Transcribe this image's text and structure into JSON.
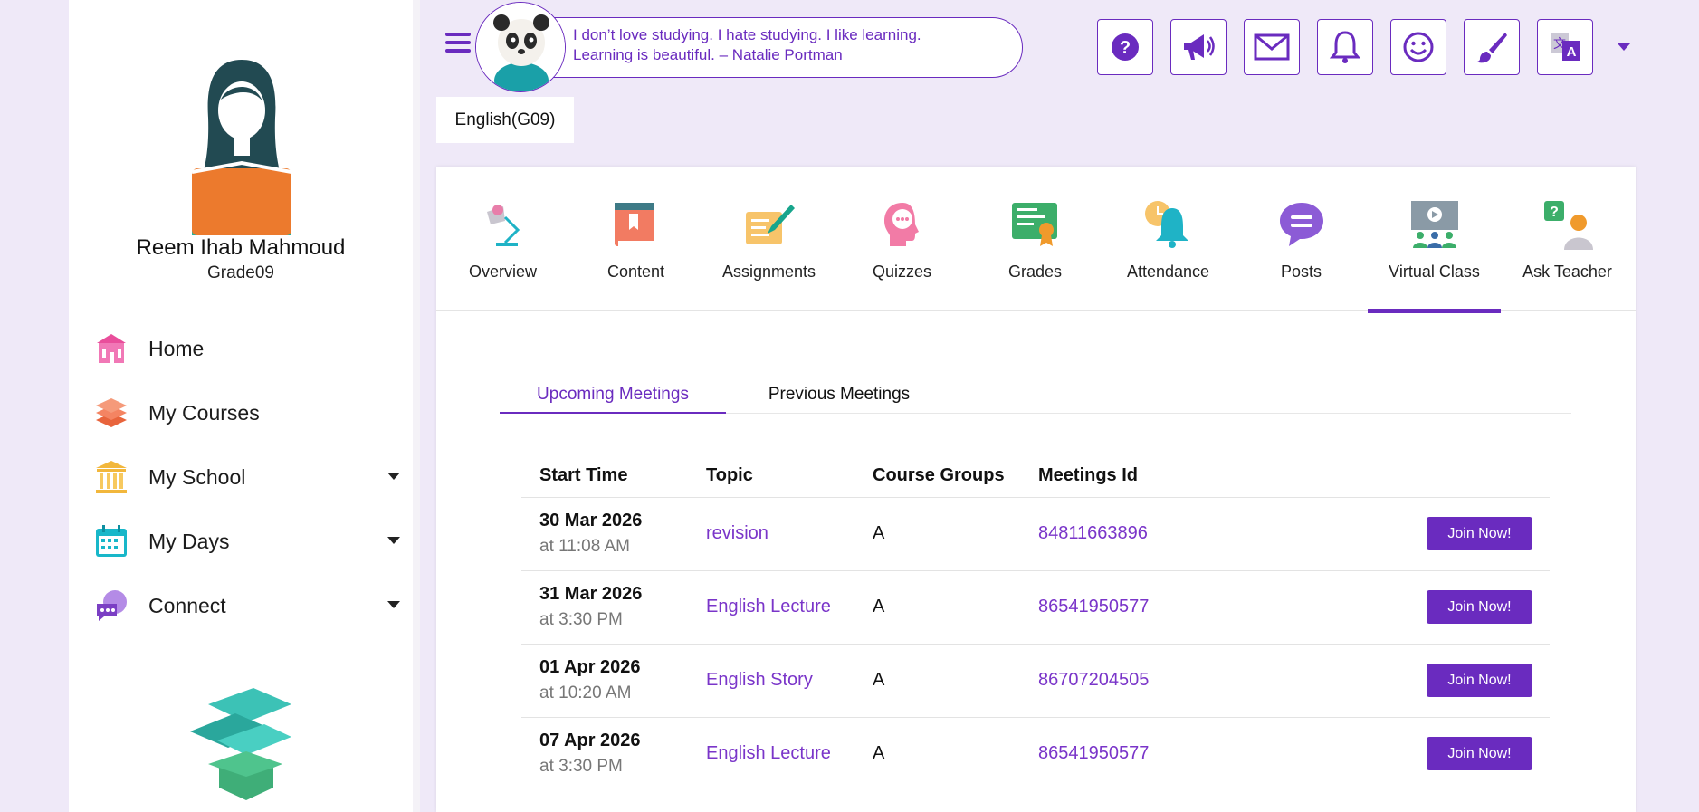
{
  "sidebar": {
    "student_name": "Reem Ihab Mahmoud",
    "grade": "Grade09",
    "nav": [
      {
        "label": "Home",
        "icon": "school-building-icon",
        "has_caret": false
      },
      {
        "label": "My Courses",
        "icon": "books-stack-icon",
        "has_caret": false
      },
      {
        "label": "My School",
        "icon": "institution-columns-icon",
        "has_caret": true
      },
      {
        "label": "My Days",
        "icon": "calendar-icon",
        "has_caret": true
      },
      {
        "label": "Connect",
        "icon": "chat-bubbles-icon",
        "has_caret": true
      }
    ]
  },
  "header": {
    "quote": "I don’t love studying. I hate studying. I like learning. Learning is beautiful. – Natalie Portman",
    "buttons": [
      "help-icon",
      "megaphone-icon",
      "mail-icon",
      "bell-icon",
      "smiley-icon",
      "brush-icon",
      "translate-icon"
    ]
  },
  "course": {
    "name": "English(G09)"
  },
  "course_tabs": [
    {
      "label": "Overview",
      "icon": "desk-lamp-icon",
      "active": false
    },
    {
      "label": "Content",
      "icon": "book-icon",
      "active": false
    },
    {
      "label": "Assignments",
      "icon": "pen-paper-icon",
      "active": false
    },
    {
      "label": "Quizzes",
      "icon": "head-thought-icon",
      "active": false
    },
    {
      "label": "Grades",
      "icon": "certificate-icon",
      "active": false
    },
    {
      "label": "Attendance",
      "icon": "bell-clock-icon",
      "active": false
    },
    {
      "label": "Posts",
      "icon": "speech-bubble-icon",
      "active": false
    },
    {
      "label": "Virtual Class",
      "icon": "presentation-icon",
      "active": true
    },
    {
      "label": "Ask Teacher",
      "icon": "question-person-icon",
      "active": false
    }
  ],
  "meetings": {
    "tabs": {
      "upcoming": "Upcoming Meetings",
      "previous": "Previous Meetings"
    },
    "columns": {
      "start_time": "Start Time",
      "topic": "Topic",
      "groups": "Course Groups",
      "id": "Meetings Id"
    },
    "join_label": "Join Now!",
    "rows": [
      {
        "date": "30 Mar 2026",
        "time": "at 11:08 AM",
        "topic": "revision",
        "group": "A",
        "id": "84811663896"
      },
      {
        "date": "31 Mar 2026",
        "time": "at 3:30 PM",
        "topic": "English Lecture",
        "group": "A",
        "id": "86541950577"
      },
      {
        "date": "01 Apr 2026",
        "time": "at 10:20 AM",
        "topic": "English Story",
        "group": "A",
        "id": "86707204505"
      },
      {
        "date": "07 Apr 2026",
        "time": "at 3:30 PM",
        "topic": "English Lecture",
        "group": "A",
        "id": "86541950577"
      }
    ]
  },
  "colors": {
    "accent": "#6a2bbf",
    "link": "#7a35c9",
    "background": "#efe9f8"
  }
}
